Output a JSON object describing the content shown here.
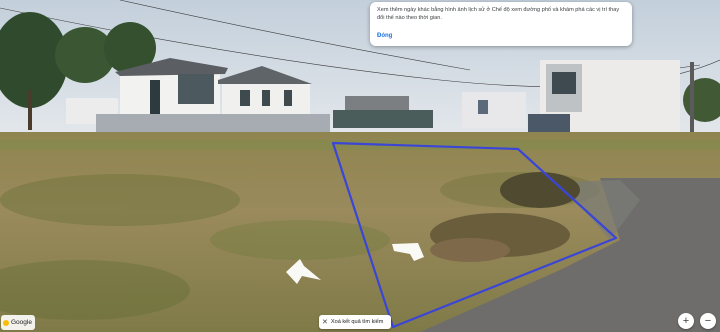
{
  "tooltip": {
    "message": "Xem thêm ngày khác bằng hình ảnh lịch sử ở Chế độ xem đường phố và khám phá các vị trí thay đổi thế nào theo thời gian.",
    "action_label": "Đóng"
  },
  "attribution": {
    "brand": "Google"
  },
  "search_results": {
    "clear_label": "Xoá kết quả tìm kiếm",
    "close_icon": "✕"
  },
  "zoom": {
    "in_label": "+",
    "out_label": "−"
  },
  "colors": {
    "plot_outline": "#3b46d6",
    "tooltip_action": "#1a73e8"
  },
  "icons": [
    "close-icon",
    "street-view-arrow-icon",
    "google-logo"
  ]
}
